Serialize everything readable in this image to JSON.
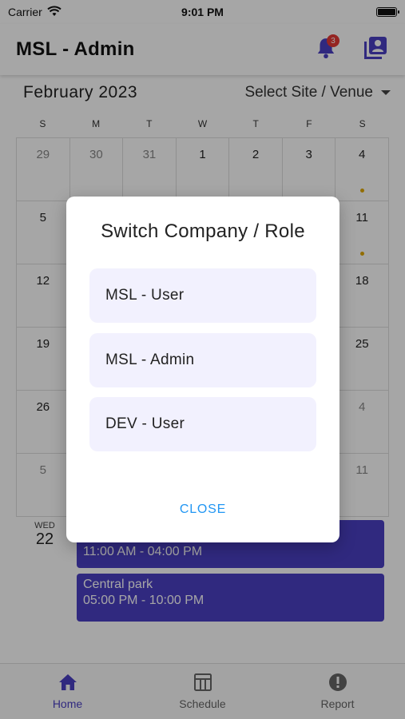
{
  "status_bar": {
    "carrier": "Carrier",
    "time": "9:01 PM"
  },
  "app_bar": {
    "title": "MSL - Admin",
    "notification_count": "3"
  },
  "calendar": {
    "month": "February 2023",
    "site_select": "Select Site / Venue",
    "weekdays": [
      "S",
      "M",
      "T",
      "W",
      "T",
      "F",
      "S"
    ],
    "days": [
      {
        "n": "29",
        "muted": true
      },
      {
        "n": "30",
        "muted": true
      },
      {
        "n": "31",
        "muted": true
      },
      {
        "n": "1"
      },
      {
        "n": "2"
      },
      {
        "n": "3"
      },
      {
        "n": "4",
        "dot": true
      },
      {
        "n": "5"
      },
      {
        "n": ""
      },
      {
        "n": ""
      },
      {
        "n": ""
      },
      {
        "n": ""
      },
      {
        "n": ""
      },
      {
        "n": "11",
        "dot": true
      },
      {
        "n": "12"
      },
      {
        "n": ""
      },
      {
        "n": ""
      },
      {
        "n": ""
      },
      {
        "n": ""
      },
      {
        "n": ""
      },
      {
        "n": "18"
      },
      {
        "n": "19"
      },
      {
        "n": ""
      },
      {
        "n": ""
      },
      {
        "n": ""
      },
      {
        "n": ""
      },
      {
        "n": ""
      },
      {
        "n": "25"
      },
      {
        "n": "26"
      },
      {
        "n": ""
      },
      {
        "n": ""
      },
      {
        "n": ""
      },
      {
        "n": ""
      },
      {
        "n": ""
      },
      {
        "n": "4",
        "muted": true
      },
      {
        "n": "5",
        "muted": true
      },
      {
        "n": ""
      },
      {
        "n": ""
      },
      {
        "n": ""
      },
      {
        "n": ""
      },
      {
        "n": ""
      },
      {
        "n": "11",
        "muted": true
      }
    ],
    "dot_color": "#e0a800"
  },
  "events": {
    "day_of_week": "WED",
    "day": "22",
    "items": [
      {
        "time": "11:00 AM - 04:00 PM"
      },
      {
        "title": "Central park",
        "time": "05:00 PM - 10:00 PM"
      }
    ],
    "color": "#4b3fc4"
  },
  "dialog": {
    "title": "Switch Company / Role",
    "options": [
      "MSL - User",
      "MSL - Admin",
      "DEV - User"
    ],
    "close_label": "CLOSE"
  },
  "bottom_nav": {
    "items": [
      {
        "label": "Home",
        "icon": "home-icon",
        "active": true
      },
      {
        "label": "Schedule",
        "icon": "table-icon"
      },
      {
        "label": "Report",
        "icon": "alert-icon"
      }
    ]
  },
  "colors": {
    "accent": "#4b3fc4",
    "close": "#2196f3",
    "badge": "#e53935"
  }
}
